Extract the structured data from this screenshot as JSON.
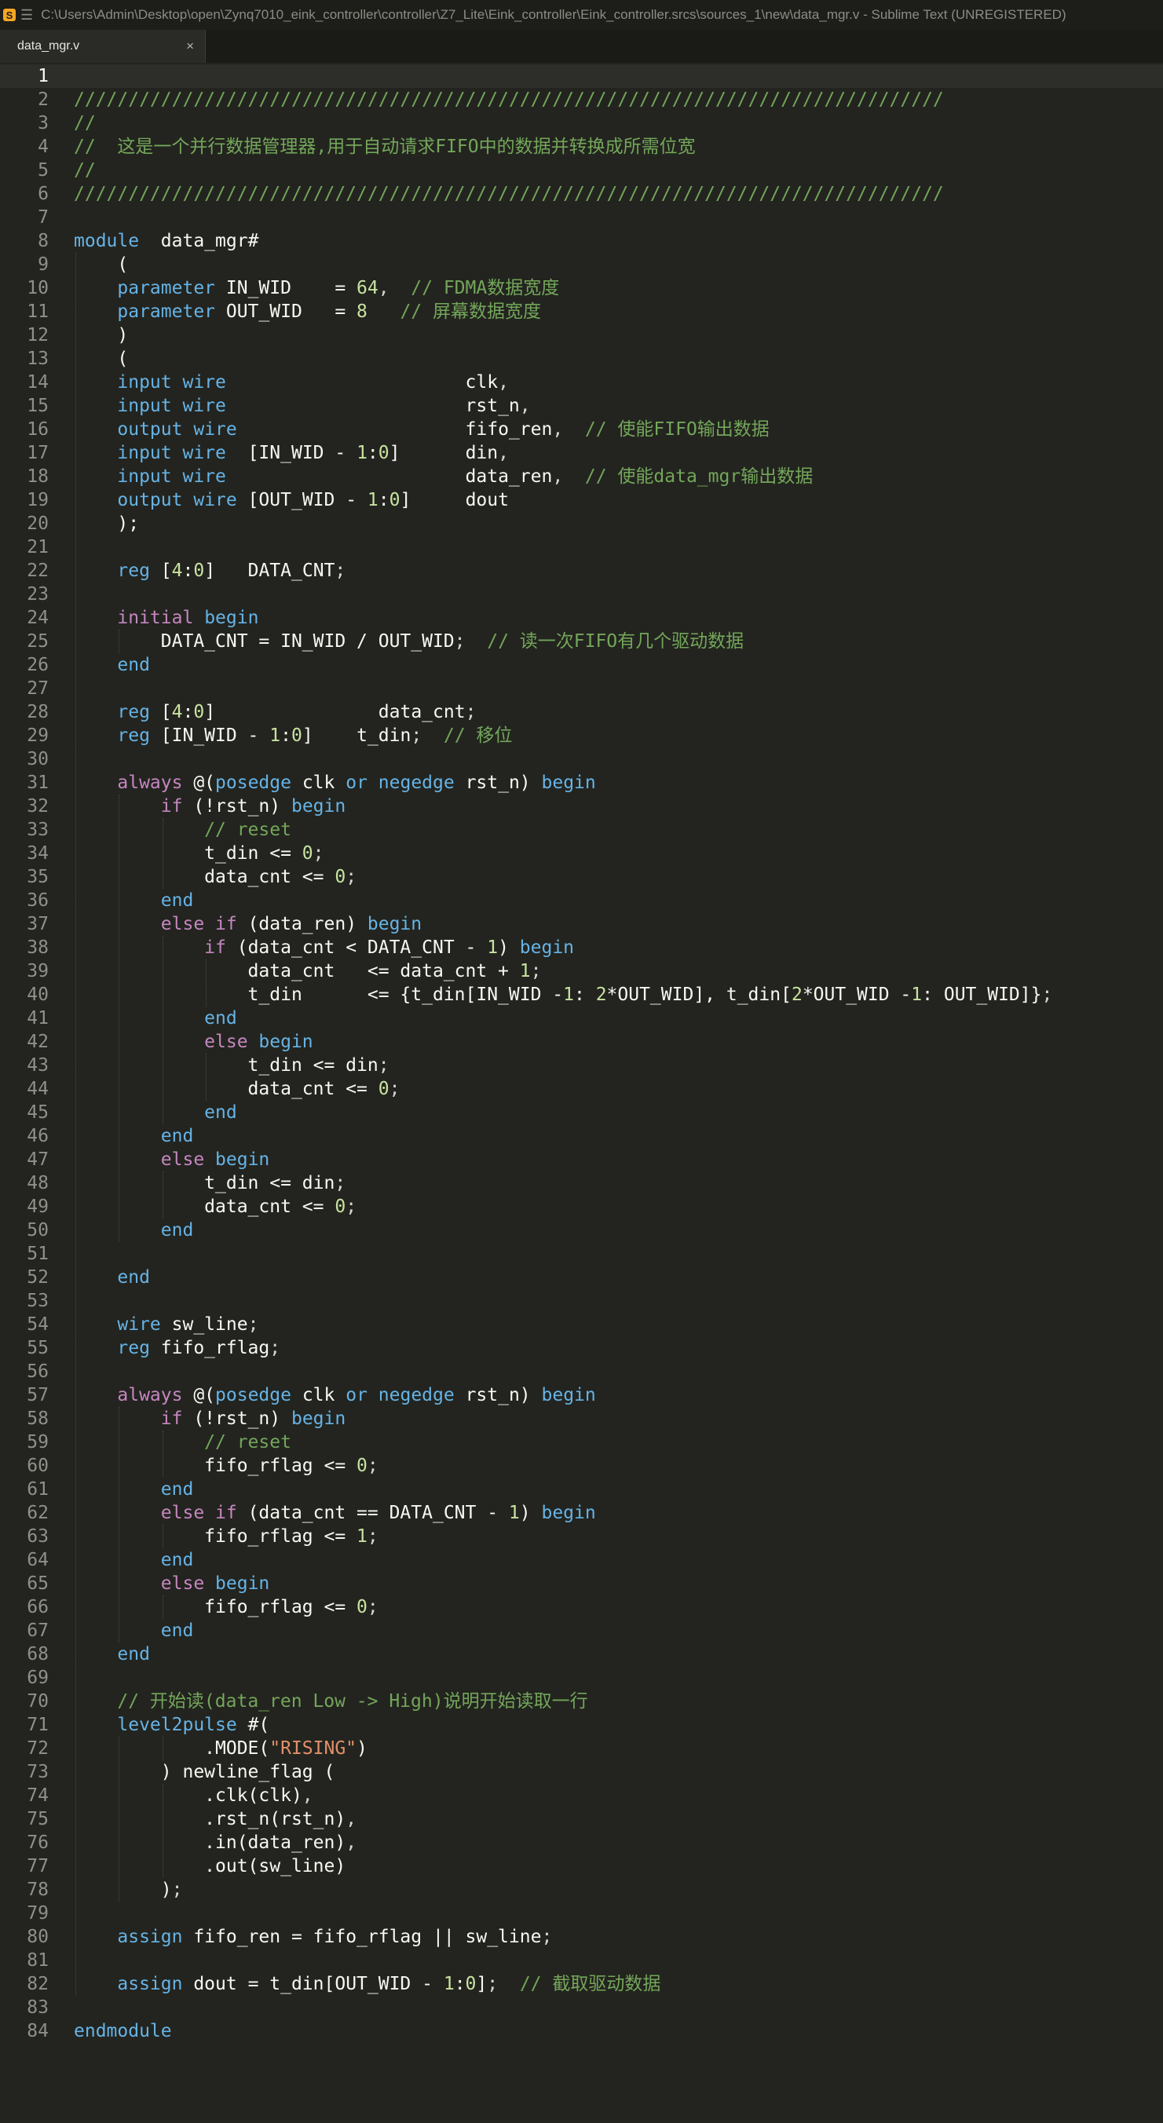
{
  "window": {
    "title": "C:\\Users\\Admin\\Desktop\\open\\Zynq7010_eink_controller\\controller\\Z7_Lite\\Eink_controller\\Eink_controller.srcs\\sources_1\\new\\data_mgr.v - Sublime Text (UNREGISTERED)"
  },
  "tabs": [
    {
      "label": "data_mgr.v",
      "close": "×",
      "active": true
    }
  ],
  "editor": {
    "current_line": 1,
    "line_count": 84
  },
  "code_lines": [
    [],
    [
      [
        "c",
        "////////////////////////////////////////////////////////////////////////////////"
      ]
    ],
    [
      [
        "c",
        "//"
      ]
    ],
    [
      [
        "c",
        "//  这是一个并行数据管理器,用于自动请求FIFO中的数据并转换成所需位宽"
      ]
    ],
    [
      [
        "c",
        "//"
      ]
    ],
    [
      [
        "c",
        "////////////////////////////////////////////////////////////////////////////////"
      ]
    ],
    [],
    [
      [
        "kb",
        "module"
      ],
      [
        "",
        "  data_mgr#"
      ]
    ],
    [
      [
        "",
        "    ("
      ]
    ],
    [
      [
        "",
        "    "
      ],
      [
        "kb",
        "parameter"
      ],
      [
        "",
        " IN_WID    = "
      ],
      [
        "n",
        "64"
      ],
      [
        "p",
        ","
      ],
      [
        "",
        "  "
      ],
      [
        "c",
        "// FDMA数据宽度"
      ]
    ],
    [
      [
        "",
        "    "
      ],
      [
        "kb",
        "parameter"
      ],
      [
        "",
        " OUT_WID   = "
      ],
      [
        "n",
        "8"
      ],
      [
        "",
        "   "
      ],
      [
        "c",
        "// 屏幕数据宽度"
      ]
    ],
    [
      [
        "",
        "    )"
      ]
    ],
    [
      [
        "",
        "    ("
      ]
    ],
    [
      [
        "",
        "    "
      ],
      [
        "kb",
        "input"
      ],
      [
        "",
        " "
      ],
      [
        "kb",
        "wire"
      ],
      [
        "",
        "                      clk"
      ],
      [
        "p",
        ","
      ]
    ],
    [
      [
        "",
        "    "
      ],
      [
        "kb",
        "input"
      ],
      [
        "",
        " "
      ],
      [
        "kb",
        "wire"
      ],
      [
        "",
        "                      rst_n"
      ],
      [
        "p",
        ","
      ]
    ],
    [
      [
        "",
        "    "
      ],
      [
        "kb",
        "output"
      ],
      [
        "",
        " "
      ],
      [
        "kb",
        "wire"
      ],
      [
        "",
        "                     fifo_ren"
      ],
      [
        "p",
        ","
      ],
      [
        "",
        "  "
      ],
      [
        "c",
        "// 使能FIFO输出数据"
      ]
    ],
    [
      [
        "",
        "    "
      ],
      [
        "kb",
        "input"
      ],
      [
        "",
        " "
      ],
      [
        "kb",
        "wire"
      ],
      [
        "",
        "  [IN_WID - "
      ],
      [
        "n",
        "1"
      ],
      [
        "",
        ":"
      ],
      [
        "n",
        "0"
      ],
      [
        "",
        "]      din"
      ],
      [
        "p",
        ","
      ]
    ],
    [
      [
        "",
        "    "
      ],
      [
        "kb",
        "input"
      ],
      [
        "",
        " "
      ],
      [
        "kb",
        "wire"
      ],
      [
        "",
        "                      data_ren"
      ],
      [
        "p",
        ","
      ],
      [
        "",
        "  "
      ],
      [
        "c",
        "// 使能data_mgr输出数据"
      ]
    ],
    [
      [
        "",
        "    "
      ],
      [
        "kb",
        "output"
      ],
      [
        "",
        " "
      ],
      [
        "kb",
        "wire"
      ],
      [
        "",
        " [OUT_WID - "
      ],
      [
        "n",
        "1"
      ],
      [
        "",
        ":"
      ],
      [
        "n",
        "0"
      ],
      [
        "",
        "]     dout"
      ]
    ],
    [
      [
        "",
        "    );"
      ]
    ],
    [],
    [
      [
        "",
        "    "
      ],
      [
        "kb",
        "reg"
      ],
      [
        "",
        " ["
      ],
      [
        "n",
        "4"
      ],
      [
        "",
        ":"
      ],
      [
        "n",
        "0"
      ],
      [
        "",
        "]   DATA_CNT"
      ],
      [
        "p",
        ";"
      ]
    ],
    [],
    [
      [
        "",
        "    "
      ],
      [
        "k",
        "initial"
      ],
      [
        "",
        " "
      ],
      [
        "kb",
        "begin"
      ]
    ],
    [
      [
        "",
        "        DATA_CNT = IN_WID / OUT_WID"
      ],
      [
        "p",
        ";"
      ],
      [
        "",
        "  "
      ],
      [
        "c",
        "// 读一次FIFO有几个驱动数据"
      ]
    ],
    [
      [
        "",
        "    "
      ],
      [
        "kb",
        "end"
      ]
    ],
    [],
    [
      [
        "",
        "    "
      ],
      [
        "kb",
        "reg"
      ],
      [
        "",
        " ["
      ],
      [
        "n",
        "4"
      ],
      [
        "",
        ":"
      ],
      [
        "n",
        "0"
      ],
      [
        "",
        "]               data_cnt"
      ],
      [
        "p",
        ";"
      ]
    ],
    [
      [
        "",
        "    "
      ],
      [
        "kb",
        "reg"
      ],
      [
        "",
        " [IN_WID - "
      ],
      [
        "n",
        "1"
      ],
      [
        "",
        ":"
      ],
      [
        "n",
        "0"
      ],
      [
        "",
        "]    t_din"
      ],
      [
        "p",
        ";"
      ],
      [
        "",
        "  "
      ],
      [
        "c",
        "// 移位"
      ]
    ],
    [],
    [
      [
        "",
        "    "
      ],
      [
        "k",
        "always"
      ],
      [
        "",
        " @("
      ],
      [
        "kb",
        "posedge"
      ],
      [
        "",
        " clk "
      ],
      [
        "kb",
        "or"
      ],
      [
        "",
        " "
      ],
      [
        "kb",
        "negedge"
      ],
      [
        "",
        " rst_n) "
      ],
      [
        "kb",
        "begin"
      ]
    ],
    [
      [
        "",
        "        "
      ],
      [
        "k",
        "if"
      ],
      [
        "",
        " (!rst_n) "
      ],
      [
        "kb",
        "begin"
      ]
    ],
    [
      [
        "",
        "            "
      ],
      [
        "c",
        "// reset"
      ]
    ],
    [
      [
        "",
        "            t_din <= "
      ],
      [
        "n",
        "0"
      ],
      [
        "p",
        ";"
      ]
    ],
    [
      [
        "",
        "            data_cnt <= "
      ],
      [
        "n",
        "0"
      ],
      [
        "p",
        ";"
      ]
    ],
    [
      [
        "",
        "        "
      ],
      [
        "kb",
        "end"
      ]
    ],
    [
      [
        "",
        "        "
      ],
      [
        "k",
        "else if"
      ],
      [
        "",
        " (data_ren) "
      ],
      [
        "kb",
        "begin"
      ]
    ],
    [
      [
        "",
        "            "
      ],
      [
        "k",
        "if"
      ],
      [
        "",
        " (data_cnt < DATA_CNT - "
      ],
      [
        "n",
        "1"
      ],
      [
        "",
        ") "
      ],
      [
        "kb",
        "begin"
      ]
    ],
    [
      [
        "",
        "                data_cnt   <= data_cnt + "
      ],
      [
        "n",
        "1"
      ],
      [
        "p",
        ";"
      ]
    ],
    [
      [
        "",
        "                t_din      <= {t_din[IN_WID -"
      ],
      [
        "n",
        "1"
      ],
      [
        "",
        ": "
      ],
      [
        "n",
        "2"
      ],
      [
        "",
        "*OUT_WID], t_din["
      ],
      [
        "n",
        "2"
      ],
      [
        "",
        "*OUT_WID -"
      ],
      [
        "n",
        "1"
      ],
      [
        "",
        ": OUT_WID]}"
      ],
      [
        "p",
        ";"
      ]
    ],
    [
      [
        "",
        "            "
      ],
      [
        "kb",
        "end"
      ]
    ],
    [
      [
        "",
        "            "
      ],
      [
        "k",
        "else"
      ],
      [
        "",
        " "
      ],
      [
        "kb",
        "begin"
      ]
    ],
    [
      [
        "",
        "                t_din <= din"
      ],
      [
        "p",
        ";"
      ]
    ],
    [
      [
        "",
        "                data_cnt <= "
      ],
      [
        "n",
        "0"
      ],
      [
        "p",
        ";"
      ]
    ],
    [
      [
        "",
        "            "
      ],
      [
        "kb",
        "end"
      ]
    ],
    [
      [
        "",
        "        "
      ],
      [
        "kb",
        "end"
      ]
    ],
    [
      [
        "",
        "        "
      ],
      [
        "k",
        "else"
      ],
      [
        "",
        " "
      ],
      [
        "kb",
        "begin"
      ]
    ],
    [
      [
        "",
        "            t_din <= din"
      ],
      [
        "p",
        ";"
      ]
    ],
    [
      [
        "",
        "            data_cnt <= "
      ],
      [
        "n",
        "0"
      ],
      [
        "p",
        ";"
      ]
    ],
    [
      [
        "",
        "        "
      ],
      [
        "kb",
        "end"
      ]
    ],
    [],
    [
      [
        "",
        "    "
      ],
      [
        "kb",
        "end"
      ]
    ],
    [],
    [
      [
        "",
        "    "
      ],
      [
        "kb",
        "wire"
      ],
      [
        "",
        " sw_line"
      ],
      [
        "p",
        ";"
      ]
    ],
    [
      [
        "",
        "    "
      ],
      [
        "kb",
        "reg"
      ],
      [
        "",
        " fifo_rflag"
      ],
      [
        "p",
        ";"
      ]
    ],
    [],
    [
      [
        "",
        "    "
      ],
      [
        "k",
        "always"
      ],
      [
        "",
        " @("
      ],
      [
        "kb",
        "posedge"
      ],
      [
        "",
        " clk "
      ],
      [
        "kb",
        "or"
      ],
      [
        "",
        " "
      ],
      [
        "kb",
        "negedge"
      ],
      [
        "",
        " rst_n) "
      ],
      [
        "kb",
        "begin"
      ]
    ],
    [
      [
        "",
        "        "
      ],
      [
        "k",
        "if"
      ],
      [
        "",
        " (!rst_n) "
      ],
      [
        "kb",
        "begin"
      ]
    ],
    [
      [
        "",
        "            "
      ],
      [
        "c",
        "// reset"
      ]
    ],
    [
      [
        "",
        "            fifo_rflag <= "
      ],
      [
        "n",
        "0"
      ],
      [
        "p",
        ";"
      ]
    ],
    [
      [
        "",
        "        "
      ],
      [
        "kb",
        "end"
      ]
    ],
    [
      [
        "",
        "        "
      ],
      [
        "k",
        "else if"
      ],
      [
        "",
        " (data_cnt == DATA_CNT - "
      ],
      [
        "n",
        "1"
      ],
      [
        "",
        ") "
      ],
      [
        "kb",
        "begin"
      ]
    ],
    [
      [
        "",
        "            fifo_rflag <= "
      ],
      [
        "n",
        "1"
      ],
      [
        "p",
        ";"
      ]
    ],
    [
      [
        "",
        "        "
      ],
      [
        "kb",
        "end"
      ]
    ],
    [
      [
        "",
        "        "
      ],
      [
        "k",
        "else"
      ],
      [
        "",
        " "
      ],
      [
        "kb",
        "begin"
      ]
    ],
    [
      [
        "",
        "            fifo_rflag <= "
      ],
      [
        "n",
        "0"
      ],
      [
        "p",
        ";"
      ]
    ],
    [
      [
        "",
        "        "
      ],
      [
        "kb",
        "end"
      ]
    ],
    [
      [
        "",
        "    "
      ],
      [
        "kb",
        "end"
      ]
    ],
    [],
    [
      [
        "",
        "    "
      ],
      [
        "c",
        "// 开始读(data_ren Low -> High)说明开始读取一行"
      ]
    ],
    [
      [
        "",
        "    "
      ],
      [
        "kb",
        "level2pulse"
      ],
      [
        "",
        " #("
      ]
    ],
    [
      [
        "",
        "            .MODE("
      ],
      [
        "s",
        "\"RISING\""
      ],
      [
        "",
        ")"
      ]
    ],
    [
      [
        "",
        "        ) newline_flag ("
      ]
    ],
    [
      [
        "",
        "            .clk(clk)"
      ],
      [
        "p",
        ","
      ]
    ],
    [
      [
        "",
        "            .rst_n(rst_n)"
      ],
      [
        "p",
        ","
      ]
    ],
    [
      [
        "",
        "            .in(data_ren)"
      ],
      [
        "p",
        ","
      ]
    ],
    [
      [
        "",
        "            .out(sw_line)"
      ]
    ],
    [
      [
        "",
        "        )"
      ],
      [
        "p",
        ";"
      ]
    ],
    [],
    [
      [
        "",
        "    "
      ],
      [
        "kb",
        "assign"
      ],
      [
        "",
        " fifo_ren = fifo_rflag || sw_line"
      ],
      [
        "p",
        ";"
      ]
    ],
    [],
    [
      [
        "",
        "    "
      ],
      [
        "kb",
        "assign"
      ],
      [
        "",
        " dout = t_din[OUT_WID - "
      ],
      [
        "n",
        "1"
      ],
      [
        "",
        ":"
      ],
      [
        "n",
        "0"
      ],
      [
        "",
        "]"
      ],
      [
        "p",
        ";"
      ],
      [
        "",
        "  "
      ],
      [
        "c",
        "// 截取驱动数据"
      ]
    ],
    [],
    [
      [
        "kb",
        "endmodule"
      ]
    ]
  ],
  "colors": {
    "background": "#23241f",
    "gutter_text": "#8f908a",
    "comment": "#73a65a",
    "keyword_pink": "#c586c0",
    "keyword_blue": "#66b3e6",
    "number": "#c8e3a0",
    "string": "#e2906a"
  },
  "icons": {
    "app": "sublime-text-logo",
    "menu": "hamburger-menu-icon",
    "tab_close": "close-icon"
  }
}
